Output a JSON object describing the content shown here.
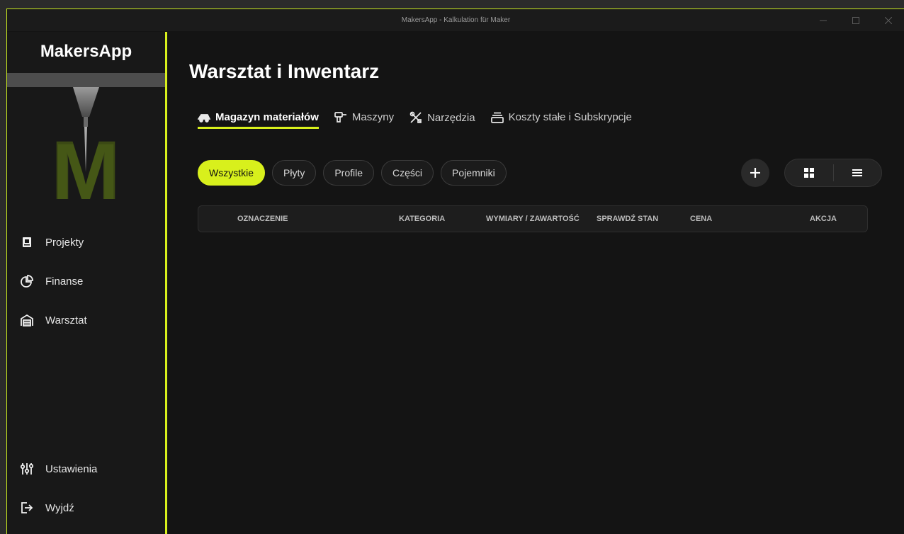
{
  "window": {
    "title": "MakersApp - Kalkulation für Maker",
    "minimize_icon": "minimize-icon",
    "maximize_icon": "maximize-icon",
    "close_icon": "close-icon"
  },
  "sidebar": {
    "brand": "MakersApp",
    "logo_letter": "M",
    "items": [
      {
        "label": "Projekty",
        "icon": "notebook-icon"
      },
      {
        "label": "Finanse",
        "icon": "pie-chart-icon"
      },
      {
        "label": "Warsztat",
        "icon": "garage-icon"
      }
    ],
    "bottom_items": [
      {
        "label": "Ustawienia",
        "icon": "sliders-icon"
      },
      {
        "label": "Wyjdź",
        "icon": "logout-icon"
      }
    ]
  },
  "main": {
    "title": "Warsztat i Inwentarz",
    "tabs": [
      {
        "label": "Magazyn materiałów",
        "icon": "truck-icon",
        "active": true
      },
      {
        "label": "Maszyny",
        "icon": "drill-icon",
        "active": false
      },
      {
        "label": "Narzędzia",
        "icon": "tools-icon",
        "active": false
      },
      {
        "label": "Koszty stałe i Subskrypcje",
        "icon": "stack-icon",
        "active": false
      }
    ],
    "filters": [
      "Wszystkie",
      "Płyty",
      "Profile",
      "Części",
      "Pojemniki"
    ],
    "active_filter": "Wszystkie",
    "add_icon": "plus-icon",
    "view_modes": [
      "grid-icon",
      "list-icon"
    ],
    "table": {
      "columns": [
        "OZNACZENIE",
        "KATEGORIA",
        "WYMIARY / ZAWARTOŚĆ",
        "SPRAWDŹ STAN",
        "CENA",
        "AKCJA"
      ]
    }
  },
  "colors": {
    "accent": "#d8f01c",
    "background": "#141414",
    "sidebar": "#181818"
  }
}
